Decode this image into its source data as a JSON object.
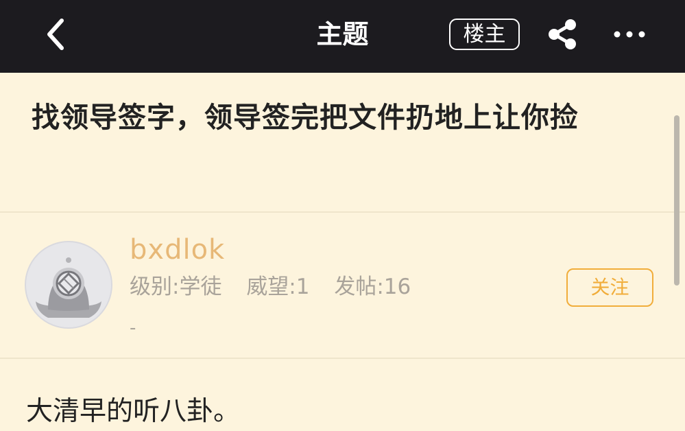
{
  "header": {
    "title": "主题",
    "op_badge": "楼主",
    "icons": {
      "back": "chevron-left-icon",
      "share": "share-icon",
      "more": "more-horizontal-icon"
    }
  },
  "thread": {
    "title": "找领导签字，领导签完把文件扔地上让你捡"
  },
  "author": {
    "username": "bxdlok",
    "avatar": "diver-helmet-avatar",
    "level": "级别:学徒",
    "reputation": "威望:1",
    "posts": "发帖:16",
    "signature": "-",
    "follow_label": "关注"
  },
  "post": {
    "body": "大清早的听八卦。"
  },
  "colors": {
    "header_bg": "#1c1b1f",
    "page_bg": "#fdf4dd",
    "username": "#e7b877",
    "accent": "#f1ad3a",
    "meta_text": "#a9a39a"
  }
}
